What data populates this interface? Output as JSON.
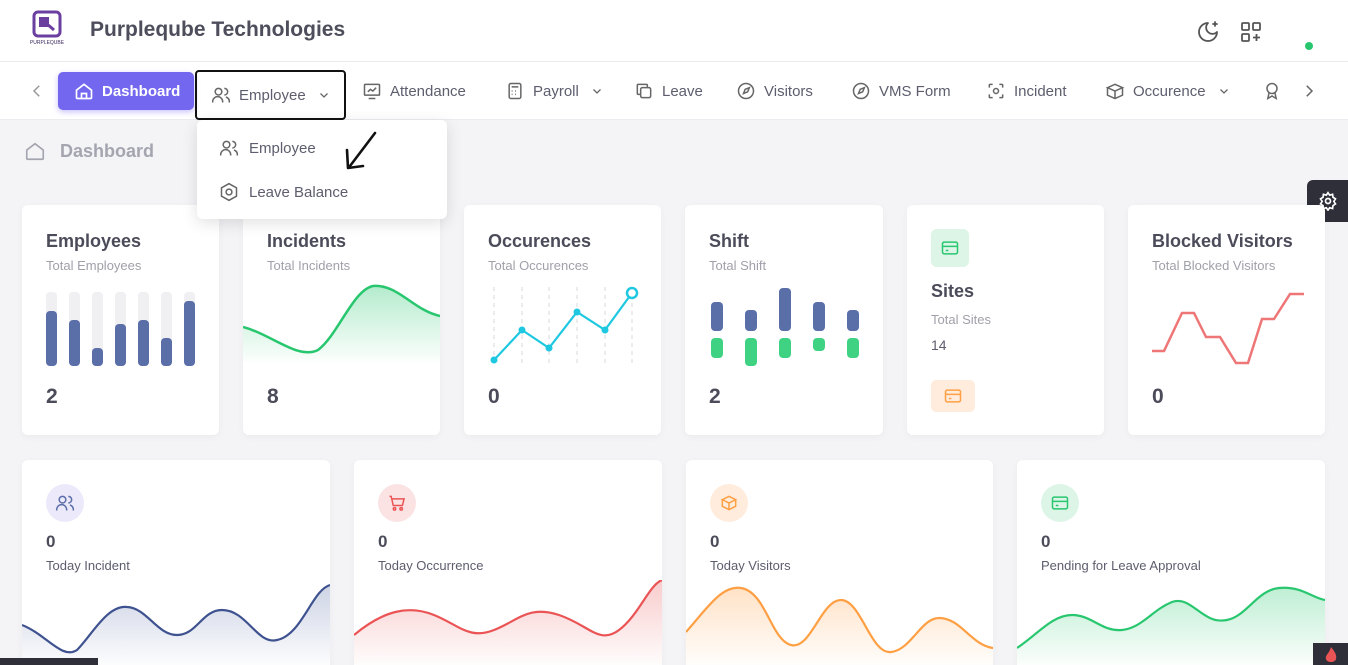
{
  "header": {
    "brand": "Purpleqube Technologies",
    "logo_text": "PURPLEQUBE",
    "icons": [
      "moon-star-icon",
      "apps-grid-icon"
    ],
    "status_color": "#28c76f"
  },
  "nav": {
    "items": [
      {
        "label": "Dashboard",
        "icon": "home-icon",
        "active": true
      },
      {
        "label": "Employee",
        "icon": "users-icon",
        "has_dropdown": true
      },
      {
        "label": "Attendance",
        "icon": "chart-monitor-icon"
      },
      {
        "label": "Payroll",
        "icon": "calculator-icon",
        "has_dropdown": true
      },
      {
        "label": "Leave",
        "icon": "copy-icon"
      },
      {
        "label": "Visitors",
        "icon": "compass-icon"
      },
      {
        "label": "VMS Form",
        "icon": "compass-icon"
      },
      {
        "label": "Incident",
        "icon": "focus-icon"
      },
      {
        "label": "Occurence",
        "icon": "box-icon",
        "has_dropdown": true
      }
    ],
    "accent": "#7367f0"
  },
  "dropdown": {
    "items": [
      {
        "label": "Employee",
        "icon": "users-icon"
      },
      {
        "label": "Leave Balance",
        "icon": "hexagon-icon"
      }
    ]
  },
  "breadcrumb": {
    "label": "Dashboard"
  },
  "summary_cards": [
    {
      "title": "Employees",
      "subtitle": "Total Employees",
      "value": "2",
      "chart": "bars",
      "color": "#5a6ea8"
    },
    {
      "title": "Incidents",
      "subtitle": "Total Incidents",
      "value": "8",
      "chart": "area",
      "color": "#28c76f"
    },
    {
      "title": "Occurences",
      "subtitle": "Total Occurences",
      "value": "0",
      "chart": "line-dots",
      "color": "#1ec8e0"
    },
    {
      "title": "Shift",
      "subtitle": "Total Shift",
      "value": "2",
      "chart": "stacked",
      "color": "#5a6ea8"
    },
    {
      "title": "Sites",
      "subtitle": "Total Sites",
      "value": "14",
      "chart": "icons",
      "color": "#28c76f"
    },
    {
      "title": "Blocked Visitors",
      "subtitle": "Total Blocked Visitors",
      "value": "0",
      "chart": "step-line",
      "color": "#ea5455"
    }
  ],
  "stat_cards": [
    {
      "value": "0",
      "label": "Today Incident",
      "icon": "users-icon",
      "color": "#5a6ea8",
      "bg": "#ece9fb"
    },
    {
      "value": "0",
      "label": "Today Occurrence",
      "icon": "cart-icon",
      "color": "#ea5455",
      "bg": "#fbe3e4"
    },
    {
      "value": "0",
      "label": "Today Visitors",
      "icon": "box-icon",
      "color": "#ff9f43",
      "bg": "#ffecdc"
    },
    {
      "value": "0",
      "label": "Pending for Leave Approval",
      "icon": "card-icon",
      "color": "#28c76f",
      "bg": "#dcf5e7"
    }
  ]
}
